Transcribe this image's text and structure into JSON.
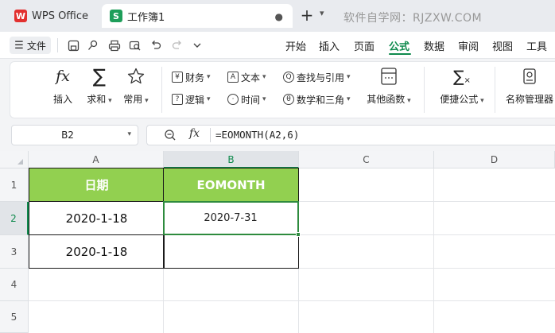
{
  "titlebar": {
    "app_tab_label": "WPS Office",
    "doc_tab_label": "工作簿1",
    "doc_tab_dot": "●",
    "new_tab_symbol": "+",
    "watermark": "软件自学网：RJZXW.COM"
  },
  "menubar": {
    "file_label": "文件",
    "items": [
      "开始",
      "插入",
      "页面",
      "公式",
      "数据",
      "审阅",
      "视图",
      "工具"
    ],
    "active_item": "公式"
  },
  "ribbon": {
    "insert_function": "插入",
    "autosum": "求和",
    "common": "常用",
    "financial": "财务",
    "text": "文本",
    "lookup": "查找与引用",
    "logical": "逻辑",
    "datetime": "时间",
    "math_trig": "数学和三角",
    "more_functions": "其他函数",
    "quick_formula": "便捷公式",
    "name_manager": "名称管理器"
  },
  "formula_bar": {
    "name_box": "B2",
    "fx": "fx",
    "formula": "=EOMONTH(A2,6)"
  },
  "grid": {
    "columns": [
      "A",
      "B",
      "C",
      "D"
    ],
    "rows": [
      "1",
      "2",
      "3",
      "4",
      "5"
    ],
    "selected_column": "B",
    "selected_row": "2",
    "header_row": [
      "日期",
      "EOMONTH"
    ],
    "data_rows": [
      [
        "2020-1-18",
        "2020-7-31"
      ],
      [
        "2020-1-18",
        ""
      ]
    ]
  },
  "colors": {
    "accent": "#0f8a4d",
    "table_header_fill": "#92d050",
    "active_cell_border": "#2e8b3e",
    "brand_red": "#e2302f",
    "sheet_green": "#1e9e5a"
  }
}
